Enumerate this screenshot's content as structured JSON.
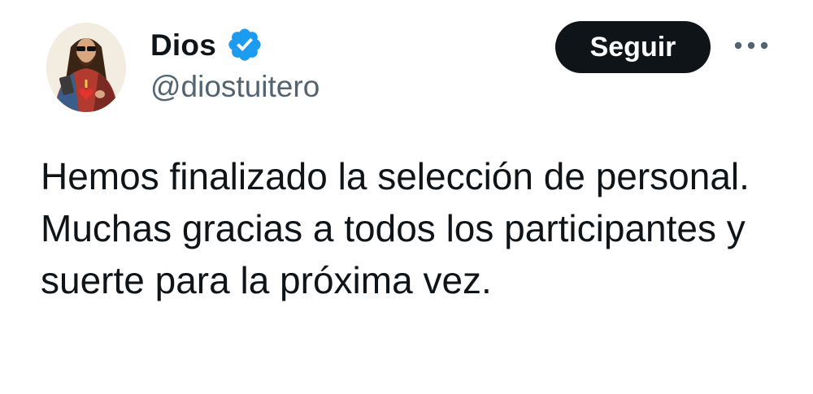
{
  "author": {
    "display_name": "Dios",
    "handle": "@diostuitero",
    "verified_icon": "verified-badge-icon",
    "avatar_icon": "sacred-heart-jesus-avatar"
  },
  "actions": {
    "follow_label": "Seguir",
    "more_icon": "more-options-icon"
  },
  "tweet": {
    "text": "Hemos finalizado la selección de personal. Muchas gracias a todos los participantes y suerte para la próxima vez."
  },
  "colors": {
    "accent": "#1d9bf0",
    "text": "#0f1419",
    "secondary": "#536471",
    "button_bg": "#0f1419",
    "button_text": "#ffffff"
  }
}
